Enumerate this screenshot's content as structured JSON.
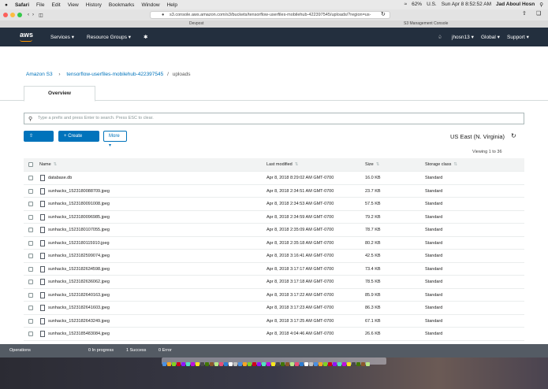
{
  "menubar": {
    "apple": "",
    "items": [
      "Safari",
      "File",
      "Edit",
      "View",
      "History",
      "Bookmarks",
      "Window",
      "Help"
    ],
    "battery": "62%",
    "locale": "U.S.",
    "clock": "Sun Apr 8  8:52:52 AM",
    "user": "Jad Aboul Hosn"
  },
  "browser": {
    "url": "s3.console.aws.amazon.com/s3/buckets/tensorflow-userfiles-mobilehub-422397545/uploads/?region=us-",
    "tab_left": "Devpost",
    "tab_right": "S3 Management Console"
  },
  "aws_nav": {
    "logo": "aws",
    "services": "Services",
    "resource_groups": "Resource Groups",
    "account": "jhosn13",
    "region": "Global",
    "support": "Support"
  },
  "breadcrumb": {
    "root": "Amazon S3",
    "bucket": "tensorflow-userfiles-mobilehub-422397545",
    "folder": "uploads"
  },
  "tabs": {
    "overview": "Overview"
  },
  "search": {
    "placeholder": "Type a prefix and press Enter to search. Press ESC to clear."
  },
  "actions": {
    "upload": "Upload",
    "create_folder": "Create folder",
    "more": "More"
  },
  "region_label": "US East (N. Virginia)",
  "viewing": "Viewing 1 to 36",
  "table": {
    "headers": {
      "name": "Name",
      "modified": "Last modified",
      "size": "Size",
      "storage": "Storage class"
    },
    "rows": [
      {
        "name": "database.db",
        "modified": "Apr 8, 2018 8:29:02 AM GMT-0700",
        "size": "16.0 KB",
        "storage": "Standard",
        "icon": "file-icon"
      },
      {
        "name": "sunhacks_1523180088709.jpeg",
        "modified": "Apr 8, 2018 2:34:51 AM GMT-0700",
        "size": "23.7 KB",
        "storage": "Standard",
        "icon": "image-icon"
      },
      {
        "name": "sunhacks_1523180091008.jpeg",
        "modified": "Apr 8, 2018 2:34:53 AM GMT-0700",
        "size": "57.5 KB",
        "storage": "Standard",
        "icon": "image-icon"
      },
      {
        "name": "sunhacks_1523180096985.jpeg",
        "modified": "Apr 8, 2018 2:34:59 AM GMT-0700",
        "size": "79.2 KB",
        "storage": "Standard",
        "icon": "image-icon"
      },
      {
        "name": "sunhacks_1523180107055.jpeg",
        "modified": "Apr 8, 2018 2:35:09 AM GMT-0700",
        "size": "78.7 KB",
        "storage": "Standard",
        "icon": "image-icon"
      },
      {
        "name": "sunhacks_1523180115910.jpeg",
        "modified": "Apr 8, 2018 2:35:18 AM GMT-0700",
        "size": "80.2 KB",
        "storage": "Standard",
        "icon": "image-icon"
      },
      {
        "name": "sunhacks_1523182599074.jpeg",
        "modified": "Apr 8, 2018 3:16:41 AM GMT-0700",
        "size": "42.5 KB",
        "storage": "Standard",
        "icon": "image-icon"
      },
      {
        "name": "sunhacks_1523182634598.jpeg",
        "modified": "Apr 8, 2018 3:17:17 AM GMT-0700",
        "size": "73.4 KB",
        "storage": "Standard",
        "icon": "image-icon"
      },
      {
        "name": "sunhacks_1523182636062.jpeg",
        "modified": "Apr 8, 2018 3:17:18 AM GMT-0700",
        "size": "78.5 KB",
        "storage": "Standard",
        "icon": "image-icon"
      },
      {
        "name": "sunhacks_1523182640163.jpeg",
        "modified": "Apr 8, 2018 3:17:22 AM GMT-0700",
        "size": "85.9 KB",
        "storage": "Standard",
        "icon": "image-icon"
      },
      {
        "name": "sunhacks_1523182641603.jpeg",
        "modified": "Apr 8, 2018 3:17:23 AM GMT-0700",
        "size": "86.3 KB",
        "storage": "Standard",
        "icon": "image-icon"
      },
      {
        "name": "sunhacks_1523182643249.jpeg",
        "modified": "Apr 8, 2018 3:17:25 AM GMT-0700",
        "size": "67.1 KB",
        "storage": "Standard",
        "icon": "image-icon"
      },
      {
        "name": "sunhacks_1523185483084.jpeg",
        "modified": "Apr 8, 2018 4:04:46 AM GMT-0700",
        "size": "26.6 KB",
        "storage": "Standard",
        "icon": "image-icon"
      }
    ]
  },
  "operations": {
    "label": "Operations",
    "in_progress": "0 In progress",
    "success": "1 Success",
    "error": "0 Error"
  },
  "colors": {
    "aws_nav": "#232f3e",
    "accent": "#0073bb",
    "aws_orange": "#ff9900",
    "ops_bar": "#545b64"
  }
}
